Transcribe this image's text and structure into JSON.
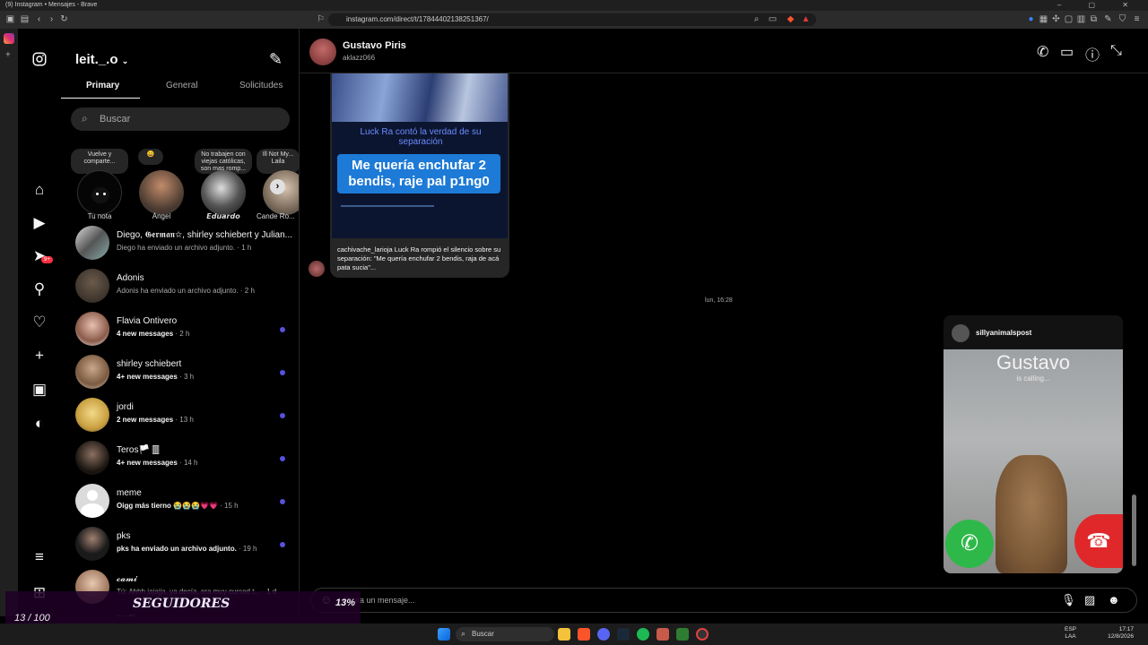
{
  "browser": {
    "window_title": "(9) Instagram • Mensajes - Brave",
    "url": "instagram.com/direct/t/17844402138251367/"
  },
  "sidebar": {
    "notification_badge": "9+"
  },
  "inbox": {
    "username": "leit._.o",
    "tabs": [
      {
        "label": "Primary"
      },
      {
        "label": "General"
      },
      {
        "label": "Solicitudes"
      }
    ],
    "search_placeholder": "Buscar",
    "notes": [
      {
        "note": "Vuelve y comparte...",
        "name": "Tu nota"
      },
      {
        "note": "😄",
        "name": "Ángel"
      },
      {
        "note": "No trabajen con viejas católicas, son mas romp...",
        "name": "𝙀𝙙𝙪𝙖𝙧𝙙𝙤"
      },
      {
        "note": "Ill Not My... Laila",
        "name": "Cande Ro..."
      }
    ],
    "conversations": [
      {
        "name": "Diego, 𝕲𝖊𝖗𝖒𝖆𝖓✩, shirley schiebert y Julian...",
        "preview": "Diego ha enviado un archivo adjunto.",
        "time": "1 h",
        "unread": false
      },
      {
        "name": "Adonis",
        "preview": "Adonis ha enviado un archivo adjunto.",
        "time": "2 h",
        "unread": false
      },
      {
        "name": "Flavia Ontivero",
        "preview": "4 new messages",
        "time": "2 h",
        "unread": true
      },
      {
        "name": "shirley schiebert",
        "preview": "4+ new messages",
        "time": "3 h",
        "unread": true
      },
      {
        "name": "jordi",
        "preview": "2 new messages",
        "time": "13 h",
        "unread": true
      },
      {
        "name": "Teros🏳️ 🀫",
        "preview": "4+ new messages",
        "time": "14 h",
        "unread": true
      },
      {
        "name": "meme",
        "preview": "Oigg más tierno 😭😭😭💗💗",
        "time": "15 h",
        "unread": true
      },
      {
        "name": "pks",
        "preview": "pks ha enviado un archivo adjunto.",
        "time": "19 h",
        "unread": true
      },
      {
        "name": "𝓬𝓪𝓶𝓲",
        "preview": "Tú: Ahhh jajajja, ya decía, era muy cursed t...",
        "time": "1 d",
        "unread": false
      },
      {
        "name": "matii",
        "preview": "",
        "time": "",
        "unread": false
      }
    ]
  },
  "chat": {
    "contact_name": "Gustavo Piris",
    "contact_username": "aklazz066",
    "post": {
      "tagline": "Luck Ra contó la verdad de su separación",
      "quote": "Me quería enchufar 2 bendis, raje pal p1ng0",
      "caption": "cachivache_larioja Luck Ra rompió el silencio sobre su separación: \"Me quería enchufar 2 bendis, raja de acá pata sucia\"..."
    },
    "timestamp": "lun, 16:28",
    "input_placeholder": "Envía un mensaje..."
  },
  "call_popup": {
    "username": "sillyanimalspost",
    "caller": "Gustavo",
    "status": "is calling..."
  },
  "overlay": {
    "count": "13 / 100",
    "label": "SEGUIDORES",
    "percent_text": "13%",
    "progress": 0.13
  },
  "taskbar": {
    "search": "Buscar",
    "lang_top": "ESP",
    "lang_bottom": "LAA",
    "time": "17:17",
    "date": "12/8/2026"
  },
  "colors": {
    "unread_dot": "#5851db",
    "accept": "#2fb84a",
    "decline": "#e0282b",
    "overlay_fill": "#b15ff2"
  }
}
